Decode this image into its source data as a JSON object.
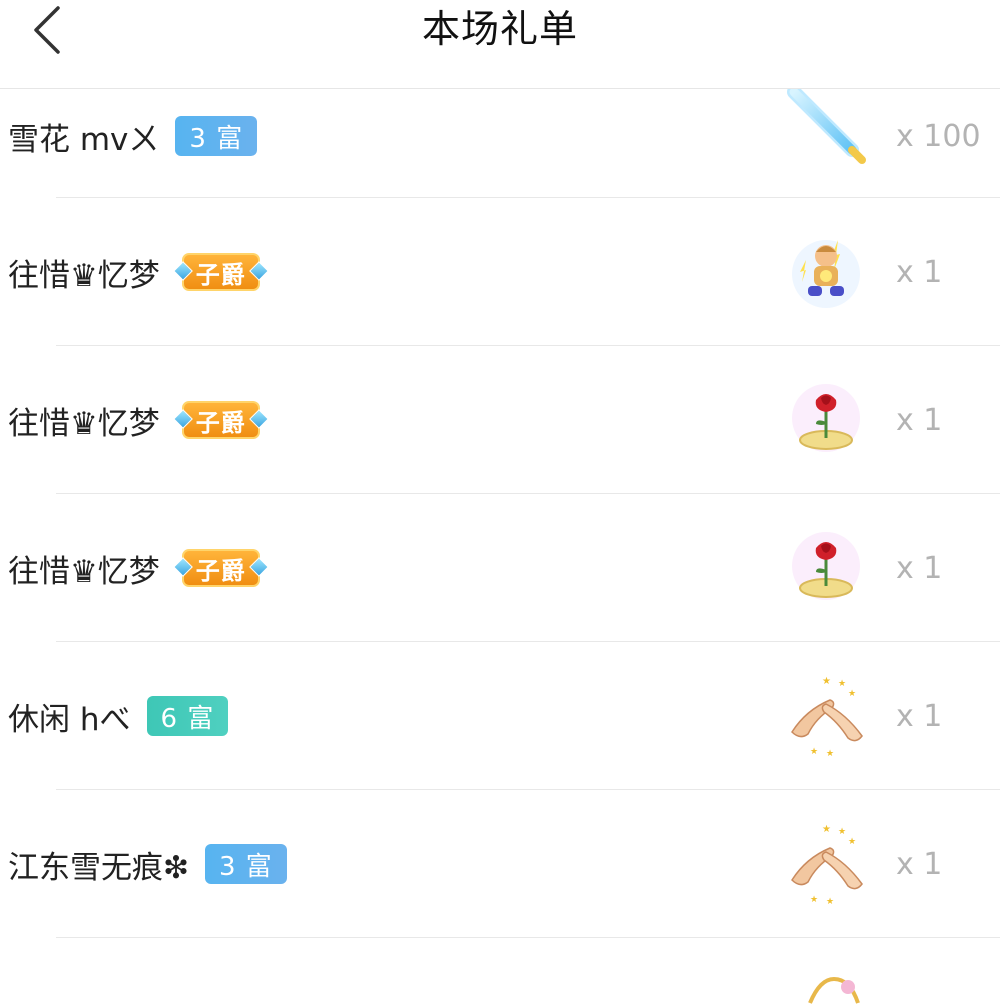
{
  "header": {
    "title": "本场礼单"
  },
  "gifts": [
    {
      "user": "雪花 mvㄨ",
      "badge": {
        "type": "level",
        "text": "3 富",
        "color": "blue"
      },
      "gift_icon": "glow-stick-icon",
      "count": "x 100"
    },
    {
      "user": "往惜♛忆梦",
      "badge": {
        "type": "title",
        "text": "子爵"
      },
      "gift_icon": "cartoon-figure-icon",
      "count": "x 1"
    },
    {
      "user": "往惜♛忆梦",
      "badge": {
        "type": "title",
        "text": "子爵"
      },
      "gift_icon": "rose-icon",
      "count": "x 1"
    },
    {
      "user": "往惜♛忆梦",
      "badge": {
        "type": "title",
        "text": "子爵"
      },
      "gift_icon": "rose-icon",
      "count": "x 1"
    },
    {
      "user": "休闲 hべ",
      "badge": {
        "type": "level",
        "text": "6 富",
        "color": "teal"
      },
      "gift_icon": "clapping-hands-icon",
      "count": "x 1"
    },
    {
      "user": "江东雪无痕❇",
      "badge": {
        "type": "level",
        "text": "3 富",
        "color": "blue"
      },
      "gift_icon": "clapping-hands-icon",
      "count": "x 1"
    }
  ],
  "colors": {
    "level_blue": "#5fb3f0",
    "level_teal": "#45ccbb",
    "title_orange": "#f5a020",
    "count_gray": "#b3b3b3"
  }
}
